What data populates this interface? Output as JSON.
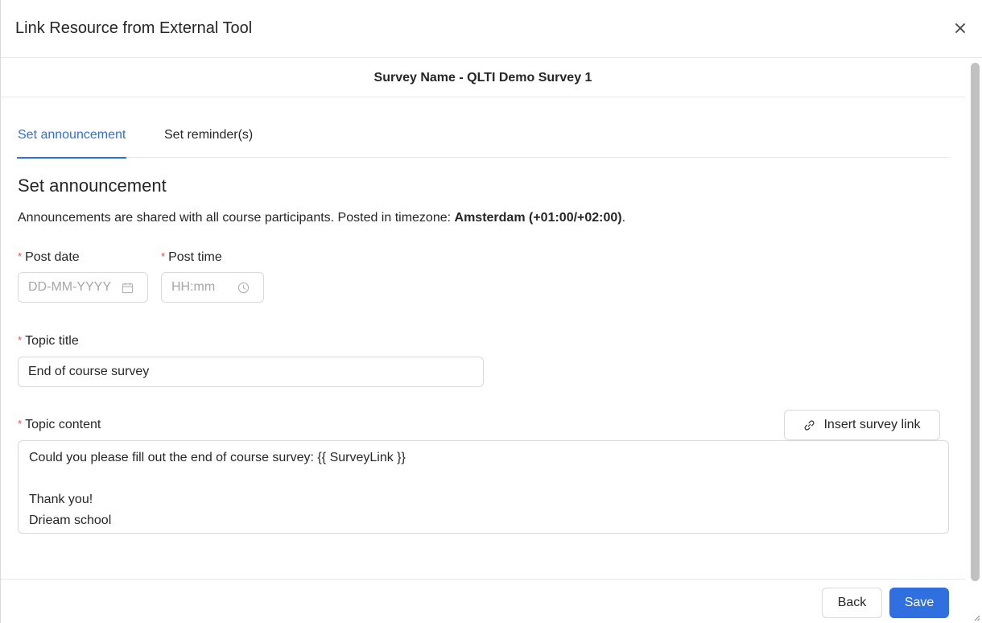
{
  "dialog": {
    "title": "Link Resource from External Tool",
    "close_icon": "close-icon"
  },
  "survey": {
    "header": "Survey Name - QLTI Demo Survey 1"
  },
  "tabs": [
    {
      "label": "Set announcement",
      "active": true
    },
    {
      "label": "Set reminder(s)",
      "active": false
    }
  ],
  "section": {
    "title": "Set announcement",
    "description_prefix": "Announcements are shared with all course participants. Posted in timezone: ",
    "timezone": "Amsterdam (+01:00/+02:00)",
    "description_suffix": "."
  },
  "form": {
    "required_marker": "*",
    "post_date": {
      "label": "Post date",
      "placeholder": "DD-MM-YYYY",
      "value": "",
      "icon": "calendar-icon"
    },
    "post_time": {
      "label": "Post time",
      "placeholder": "HH:mm",
      "value": "",
      "icon": "clock-icon"
    },
    "topic_title": {
      "label": "Topic title",
      "value": "End of course survey"
    },
    "topic_content": {
      "label": "Topic content",
      "value": "Could you please fill out the end of course survey:  {{ SurveyLink }}\n\nThank you!\nDrieam school"
    },
    "insert_link_button": {
      "label": "Insert survey link",
      "icon": "link-icon"
    }
  },
  "footer": {
    "back_label": "Back",
    "save_label": "Save"
  },
  "colors": {
    "accent": "#2f6fe0",
    "required": "#ff4d4f",
    "border": "#d9d9d9"
  }
}
